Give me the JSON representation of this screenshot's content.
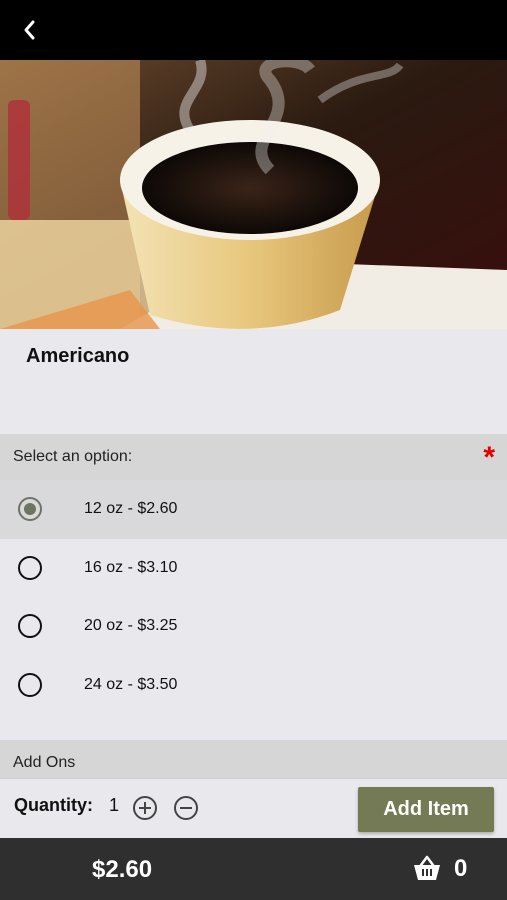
{
  "header": {
    "back_icon": "chevron-left-icon"
  },
  "product": {
    "name": "Americano",
    "image": "steaming-coffee-cup"
  },
  "options_section": {
    "label": "Select an option:",
    "required_mark": "*",
    "required_color": "#e00000",
    "items": [
      {
        "label": "12 oz - $2.60",
        "selected": true
      },
      {
        "label": "16 oz - $3.10",
        "selected": false
      },
      {
        "label": "20 oz - $3.25",
        "selected": false
      },
      {
        "label": "24 oz - $3.50",
        "selected": false
      }
    ]
  },
  "addons_section": {
    "label": "Add Ons"
  },
  "quantity": {
    "label": "Quantity:",
    "value": "1",
    "plus_icon": "plus-circle-icon",
    "minus_icon": "minus-circle-icon",
    "add_button_label": "Add Item",
    "accent_color": "#737a54"
  },
  "footer": {
    "total": "$2.60",
    "cart_icon": "basket-icon",
    "cart_count": "0"
  }
}
